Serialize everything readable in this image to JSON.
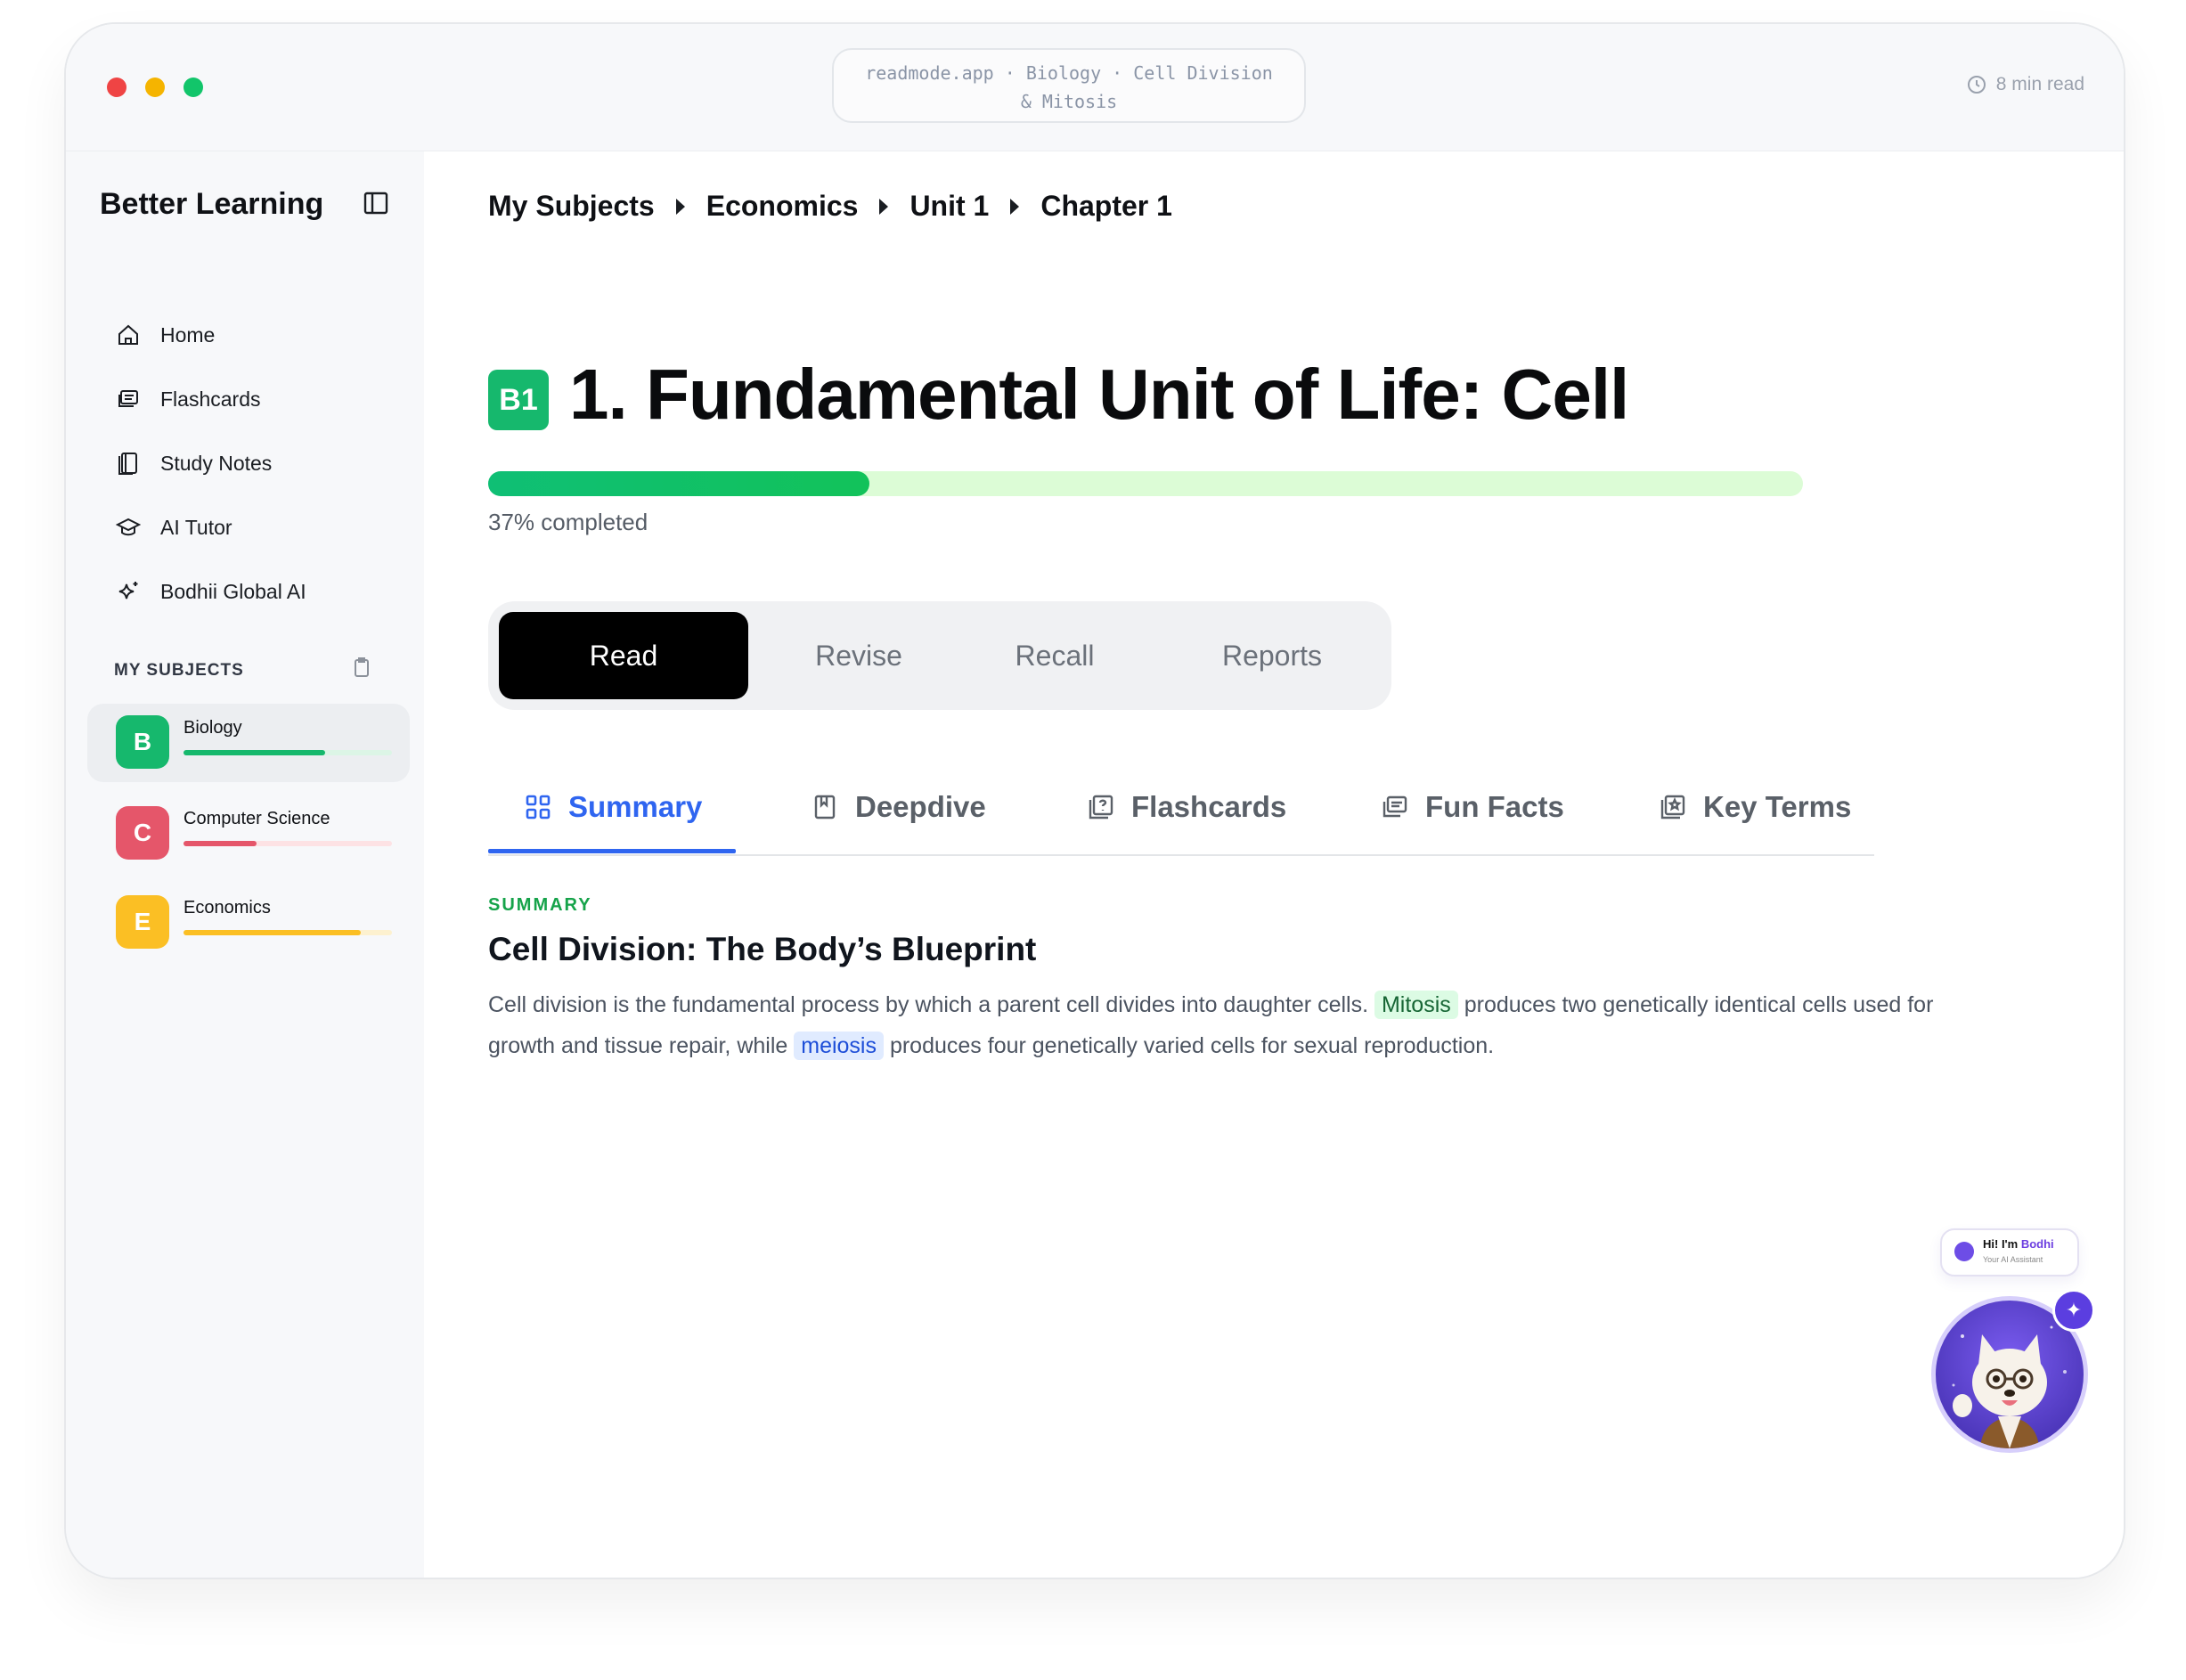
{
  "window": {
    "url_line1": "readmode.app · Biology · Cell Division",
    "url_line2": "& Mitosis",
    "read_time": "8 min read",
    "dot_colors": [
      "#ef4444",
      "#f5b400",
      "#12c56a"
    ]
  },
  "sidebar": {
    "brand": "Better Learning",
    "nav": [
      {
        "label": "Home",
        "icon": "home-icon"
      },
      {
        "label": "Flashcards",
        "icon": "flashcards-icon"
      },
      {
        "label": "Study Notes",
        "icon": "notebook-icon"
      },
      {
        "label": "AI Tutor",
        "icon": "graduation-cap-icon"
      },
      {
        "label": "Bodhii Global AI",
        "icon": "sparkle-icon"
      }
    ],
    "subjects_heading": "MY SUBJECTS",
    "subjects": [
      {
        "letter": "B",
        "name": "Biology",
        "color": "#16b86d",
        "track": "#dcf5e6",
        "progress": 0.68,
        "active": true
      },
      {
        "letter": "C",
        "name": "Computer Science",
        "color": "#e5566a",
        "track": "#fde2e4",
        "progress": 0.35,
        "active": false
      },
      {
        "letter": "E",
        "name": "Economics",
        "color": "#fbbf24",
        "track": "#fdf1cf",
        "progress": 0.85,
        "active": false
      }
    ]
  },
  "breadcrumb": [
    "My Subjects",
    "Economics",
    "Unit 1",
    "Chapter 1"
  ],
  "chapter": {
    "badge": "B1",
    "title": "1. Fundamental Unit of Life: Cell",
    "progress": 0.29,
    "progress_text": "37% completed"
  },
  "modes": [
    "Read",
    "Revise",
    "Recall",
    "Reports"
  ],
  "active_mode": "Read",
  "tabs": [
    {
      "label": "Summary",
      "icon": "grid-icon"
    },
    {
      "label": "Deepdive",
      "icon": "bookmark-icon"
    },
    {
      "label": "Flashcards",
      "icon": "question-card-icon"
    },
    {
      "label": "Fun Facts",
      "icon": "cards-icon"
    },
    {
      "label": "Key Terms",
      "icon": "star-card-icon"
    }
  ],
  "active_tab": "Summary",
  "content": {
    "eyebrow": "SUMMARY",
    "heading": "Cell Division: The Body’s Blueprint",
    "para_part1": "Cell division is the fundamental process by which a parent cell divides into daughter cells.",
    "term1": "Mitosis",
    "para_part2": "produces two genetically identical cells used for growth and tissue repair, while",
    "term2": "meiosis",
    "para_part3": "produces four genetically varied cells for sexual reproduction."
  },
  "assistant": {
    "greeting_prefix": "Hi! I'm",
    "name": "Bodhi",
    "subtitle": "Your AI Assistant"
  },
  "colors": {
    "accent_blue": "#2f65f0",
    "brand_green": "#16b86d",
    "assistant_purple": "#6d3fe0"
  }
}
